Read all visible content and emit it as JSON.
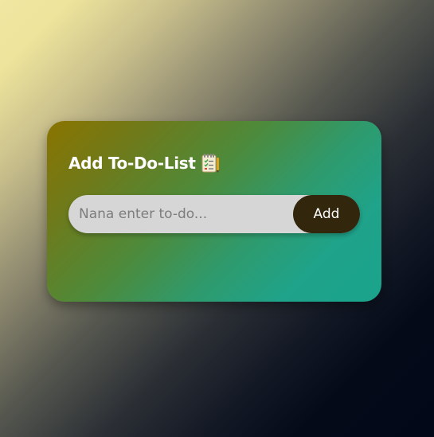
{
  "card": {
    "title": "Add To-Do-List",
    "title_icon": "notepad-checklist-icon"
  },
  "todo_form": {
    "input_value": "",
    "input_placeholder": "Nana enter to-do...",
    "add_label": "Add"
  },
  "colors": {
    "card_gradient_start": "#8a7400",
    "card_gradient_end": "#1aa38c",
    "input_background": "#d6d6d6",
    "button_background": "#32260c",
    "title_text": "#ffffff"
  }
}
